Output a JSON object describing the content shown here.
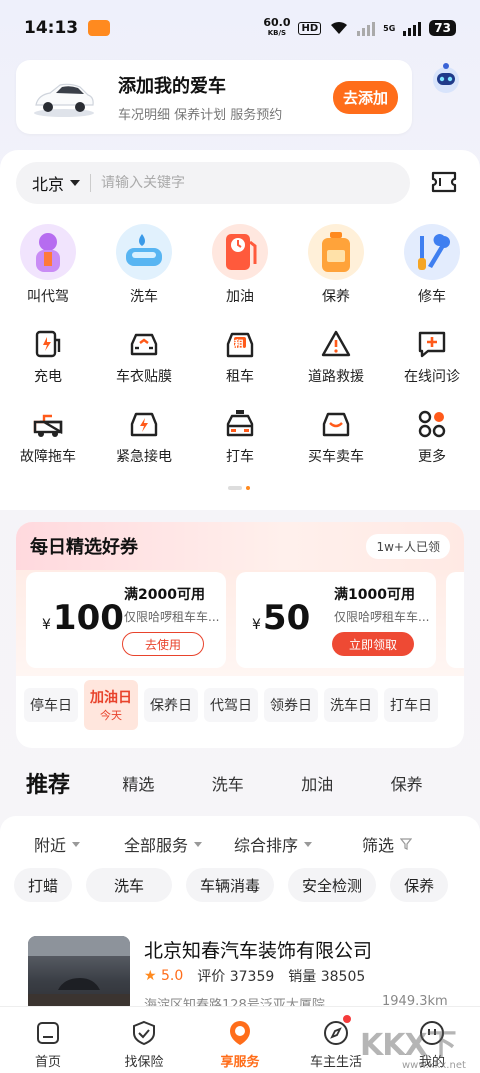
{
  "status_bar": {
    "time": "14:13",
    "net_speed": "60.0",
    "net_unit": "KB/S",
    "hd": "HD",
    "cell": "5G",
    "battery": "73"
  },
  "banner": {
    "title": "添加我的爱车",
    "subtitle": "车况明细 保养计划 服务预约",
    "add_button": "去添加"
  },
  "search": {
    "city": "北京",
    "placeholder": "请输入关键字"
  },
  "services": {
    "row1": [
      {
        "label": "叫代驾",
        "icon": "driver-icon",
        "color": "#c98cf5"
      },
      {
        "label": "洗车",
        "icon": "car-wash-icon",
        "color": "#58b5f2"
      },
      {
        "label": "加油",
        "icon": "fuel-pump-icon",
        "color": "#ff5a3c"
      },
      {
        "label": "保养",
        "icon": "oil-can-icon",
        "color": "#ffa33a"
      },
      {
        "label": "修车",
        "icon": "repair-tools-icon",
        "color": "#3f7ff0"
      }
    ],
    "row2": [
      {
        "label": "充电",
        "icon": "charging-icon"
      },
      {
        "label": "车衣贴膜",
        "icon": "car-film-icon"
      },
      {
        "label": "租车",
        "icon": "rent-car-icon",
        "badge": "租"
      },
      {
        "label": "道路救援",
        "icon": "road-rescue-icon"
      },
      {
        "label": "在线问诊",
        "icon": "online-consult-icon"
      }
    ],
    "row3": [
      {
        "label": "故障拖车",
        "icon": "tow-truck-icon"
      },
      {
        "label": "紧急接电",
        "icon": "jump-start-icon"
      },
      {
        "label": "打车",
        "icon": "taxi-icon"
      },
      {
        "label": "买车卖车",
        "icon": "buy-sell-car-icon"
      },
      {
        "label": "更多",
        "icon": "more-grid-icon"
      }
    ]
  },
  "coupons": {
    "title": "每日精选好券",
    "badge": "1w+人已领",
    "items": [
      {
        "currency": "¥",
        "amount": "100",
        "title": "满2000可用",
        "desc": "仅限哈啰租车车...",
        "button": "去使用",
        "button_style": "outline"
      },
      {
        "currency": "¥",
        "amount": "50",
        "title": "满1000可用",
        "desc": "仅限哈啰租车车...",
        "button": "立即领取",
        "button_style": "filled"
      }
    ],
    "days": [
      "停车日",
      "加油日",
      "保养日",
      "代驾日",
      "领券日",
      "洗车日",
      "打车日"
    ],
    "active_day_sub": "今天"
  },
  "recommend": {
    "title": "推荐",
    "tabs": [
      "精选",
      "洗车",
      "加油",
      "保养"
    ]
  },
  "filters": {
    "items": [
      "附近",
      "全部服务",
      "综合排序",
      "筛选"
    ],
    "chips": [
      "打蜡",
      "洗车",
      "车辆消毒",
      "安全检测",
      "保养"
    ]
  },
  "shop": {
    "name": "北京知春汽车装饰有限公司",
    "rating": "5.0",
    "reviews": "评价 37359",
    "sales": "销量 38505",
    "address": "海淀区知春路128号泛亚大厦院",
    "distance": "1949.3km"
  },
  "nav": [
    {
      "label": "首页",
      "icon": "home-icon"
    },
    {
      "label": "找保险",
      "icon": "insurance-shield-icon"
    },
    {
      "label": "享服务",
      "icon": "service-pin-icon",
      "active": true
    },
    {
      "label": "车主生活",
      "icon": "compass-icon"
    },
    {
      "label": "我的",
      "icon": "profile-icon"
    }
  ],
  "watermark": {
    "text": "KKX下载",
    "url": "www.kkx.net"
  },
  "colors": {
    "accent": "#ff6d1a",
    "coupon_red": "#e8432c"
  }
}
